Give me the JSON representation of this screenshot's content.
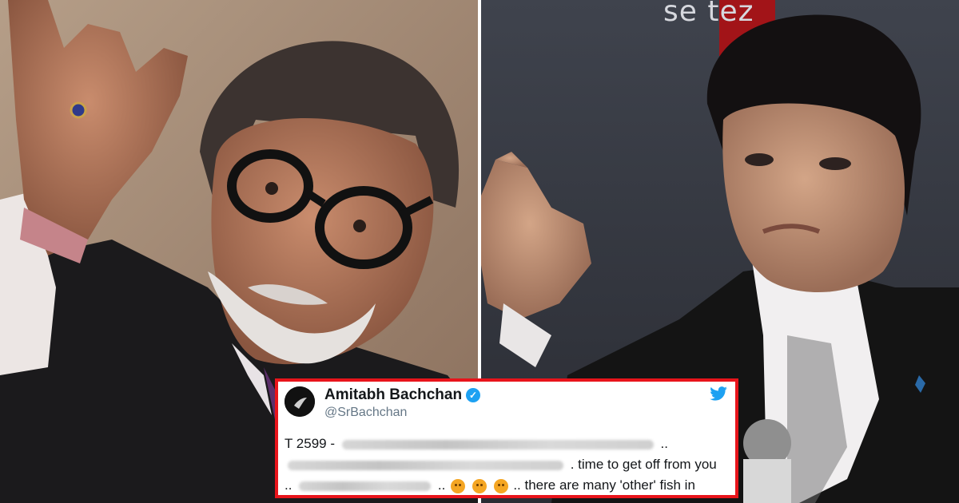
{
  "tweet": {
    "name": "Amitabh Bachchan",
    "handle": "@SrBachchan",
    "line1_prefix": "T 2599 -",
    "line1_suffix": "..",
    "line2_suffix": ". time to get off from you",
    "line3_prefix": "..",
    "line3_mid": "..",
    "line3_suffix": ".. there are many 'other' fish in",
    "emojis": [
      "angry-face",
      "angry-face",
      "angry-face"
    ]
  },
  "background_sign": "se tez",
  "colors": {
    "frame": "#e8141b",
    "twitter_blue": "#1da1f2",
    "name_text": "#14171a",
    "handle_text": "#657786"
  }
}
